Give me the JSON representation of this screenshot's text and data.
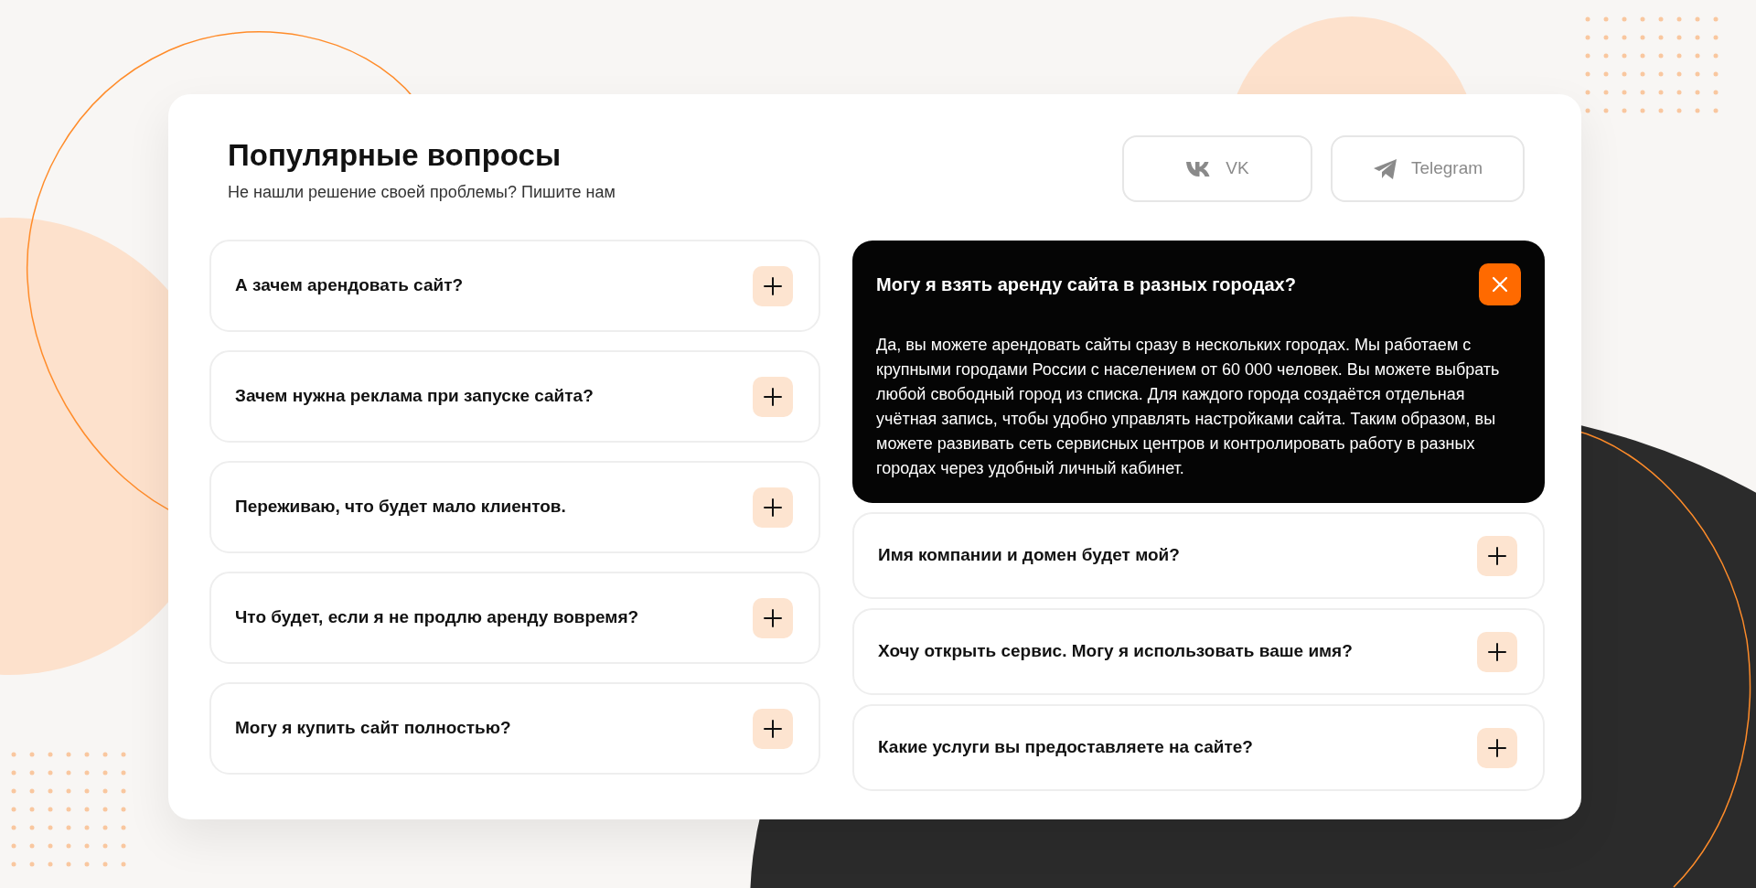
{
  "header": {
    "title": "Популярные вопросы",
    "subtitle": "Не нашли решение своей проблемы? Пишите нам"
  },
  "social_buttons": [
    {
      "kind": "vk",
      "label": "VK"
    },
    {
      "kind": "telegram",
      "label": "Telegram"
    }
  ],
  "faq_columns": [
    [
      {
        "question": "А зачем арендовать сайт?",
        "expanded": false
      },
      {
        "question": "Зачем нужна реклама при запуске сайта?",
        "expanded": false
      },
      {
        "question": "Переживаю, что будет мало клиентов.",
        "expanded": false
      },
      {
        "question": "Что будет, если я не продлю аренду вовремя?",
        "expanded": false
      },
      {
        "question": "Могу я купить сайт полностью?",
        "expanded": false
      }
    ],
    [
      {
        "question": "Могу я взять аренду сайта в разных городах?",
        "expanded": true,
        "answer": "Да, вы можете арендовать сайты сразу в нескольких городах. Мы работаем с крупными городами России с населением от 60 000 человек. Вы можете выбрать любой свободный город из списка. Для каждого города создаётся отдельная учётная запись, чтобы удобно управлять настройками сайта. Таким образом, вы можете развивать сеть сервисных центров и контролировать работу в разных городах через удобный личный кабинет."
      },
      {
        "question": "Имя компании и домен будет мой?",
        "expanded": false
      },
      {
        "question": "Хочу открыть сервис. Могу я использовать ваше имя?",
        "expanded": false
      },
      {
        "question": "Какие услуги вы предоставляете на сайте?",
        "expanded": false
      }
    ]
  ]
}
